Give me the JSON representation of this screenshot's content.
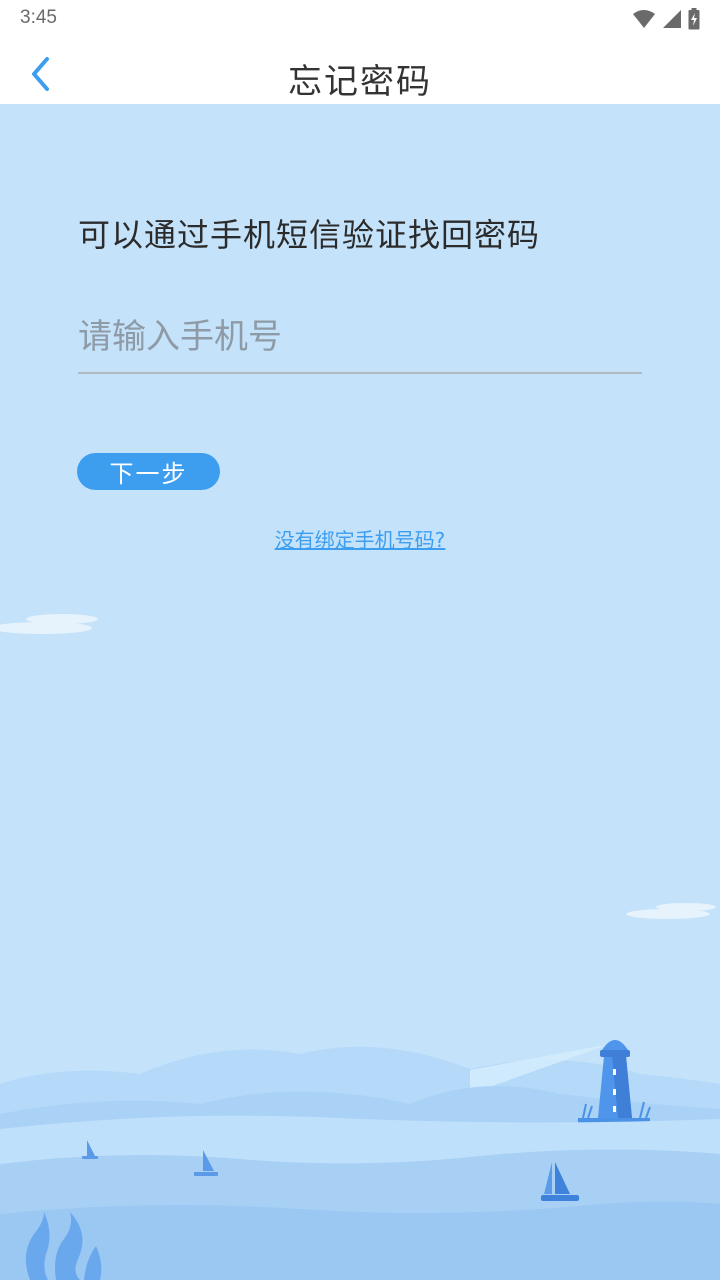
{
  "status_bar": {
    "time": "3:45",
    "icons": [
      "wifi-icon",
      "cell-signal-icon",
      "battery-charging-icon"
    ]
  },
  "header": {
    "title": "忘记密码",
    "back_icon": "chevron-left-icon"
  },
  "form": {
    "hint": "可以通过手机短信验证找回密码",
    "phone_placeholder": "请输入手机号",
    "phone_value": "",
    "next_label": "下一步",
    "no_phone_link": "没有绑定手机号码?"
  },
  "colors": {
    "accent": "#3d9ef0",
    "background": "#c4e3fb",
    "header_bg": "#ffffff"
  }
}
